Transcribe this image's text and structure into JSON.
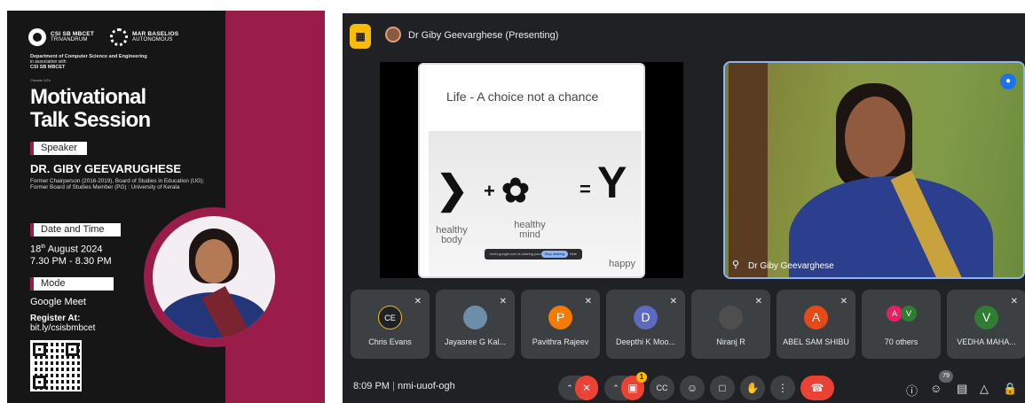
{
  "poster": {
    "logo_left": {
      "line1": "CSI SB MBCET",
      "line2": "TRIVANDRUM"
    },
    "logo_right": {
      "line1": "MAR BASELIOS",
      "line2": "AUTONOMOUS"
    },
    "dept_line1": "Department of Computer Science and Engineering",
    "dept_line2": "in association with",
    "dept_line3": "CSI SB MBCET",
    "circular": "Circular 1/24",
    "title_line1": "Motivational",
    "title_line2": "Talk Session",
    "speaker_label": "Speaker",
    "speaker_name": "DR. GIBY GEEVARUGHESE",
    "speaker_info": "Former Chairperson (2016-2019), Board of Studies in Education (UG); Former Board of Studies Member (PG) : University of Kerala",
    "date_label": "Date and Time",
    "date_day": "18",
    "date_sup": "th",
    "date_month": " August 2024",
    "time": "7.30 PM - 8.30 PM",
    "mode_label": "Mode",
    "mode_value": "Google Meet",
    "register_title": "Register At:",
    "register_link": "bit.ly/csisbmbcet"
  },
  "meet": {
    "presenter_label": "Dr Giby Geevarghese (Presenting)",
    "slide": {
      "heading": "Life - A choice not a chance",
      "cap1_line1": "healthy",
      "cap1_line2": "body",
      "cap2_line1": "healthy",
      "cap2_line2": "mind",
      "cap3": "happy",
      "toast_text": "meet.google.com is sharing your screen.",
      "toast_button": "Stop sharing",
      "toast_hide": "Hide"
    },
    "camera_name": "Dr Giby Geevarghese",
    "participants": [
      {
        "name": "Chris Evans",
        "initial": "CE",
        "color": "#202124"
      },
      {
        "name": "Jayasree G Kal...",
        "initial": "",
        "color": "#6c8ea8"
      },
      {
        "name": "Pavithra Rajeev",
        "initial": "P",
        "color": "#f57c00"
      },
      {
        "name": "Deepthi K Moo...",
        "initial": "D",
        "color": "#5c6bc0"
      },
      {
        "name": "Niranj R",
        "initial": "",
        "color": "#4e4e4e"
      },
      {
        "name": "ABEL SAM SHIBU",
        "initial": "A",
        "color": "#e64a19"
      },
      {
        "name": "70 others",
        "initial": "",
        "color": ""
      },
      {
        "name": "VEDHA MAHA...",
        "initial": "V",
        "color": "#2e7d32"
      }
    ],
    "others_avatars": [
      {
        "initial": "A",
        "color": "#e91e63"
      },
      {
        "initial": "V",
        "color": "#2e7d32"
      }
    ],
    "time": "8:09 PM",
    "meeting_code": "nmi-uuof-ogh",
    "video_badge": "1",
    "people_count": "79"
  },
  "icons": [
    "presentation-icon",
    "mic-off-icon",
    "camera-off-icon",
    "captions-icon",
    "emoji-icon",
    "present-screen-icon",
    "raise-hand-icon",
    "more-options-icon",
    "leave-call-icon",
    "info-icon",
    "people-icon",
    "chat-icon",
    "activities-icon",
    "host-controls-icon",
    "pin-icon",
    "speaking-indicator-icon"
  ]
}
